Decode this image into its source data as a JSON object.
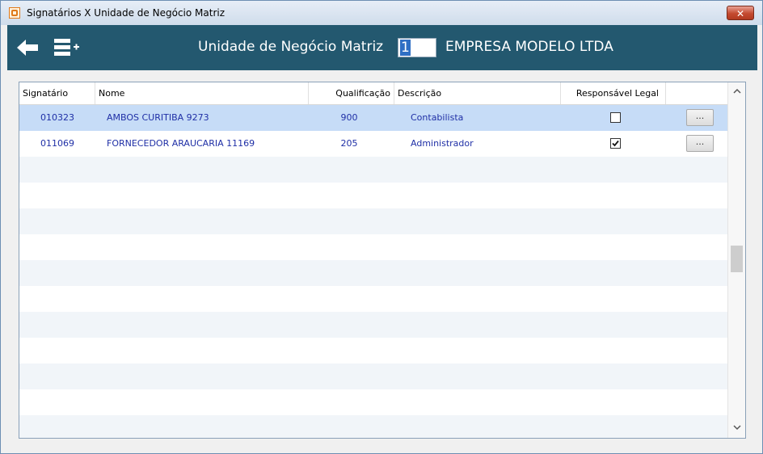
{
  "window": {
    "title": "Signatários X Unidade de Negócio Matriz",
    "close_label": "✕"
  },
  "toolbar": {
    "label": "Unidade de Negócio Matriz",
    "input_value": "1",
    "company": "EMPRESA MODELO LTDA"
  },
  "grid": {
    "headers": {
      "signatario": "Signatário",
      "nome": "Nome",
      "qualificacao": "Qualificação",
      "descricao": "Descrição",
      "responsavel": "Responsável Legal"
    },
    "rows": [
      {
        "signatario": "010323",
        "nome": "AMBOS CURITIBA 9273",
        "qualificacao": "900",
        "descricao": "Contabilista",
        "responsavel_legal": false,
        "action_label": "..."
      },
      {
        "signatario": "011069",
        "nome": "FORNECEDOR ARAUCARIA 11169",
        "qualificacao": "205",
        "descricao": "Administrador",
        "responsavel_legal": true,
        "action_label": "..."
      }
    ]
  },
  "colors": {
    "toolbar_bg": "#23586f",
    "selected_row": "#c6dcf7",
    "cell_text": "#1f2fa6"
  },
  "icons": [
    "app-logo-icon",
    "close-icon",
    "back-arrow-icon",
    "menu-add-icon",
    "scroll-up-icon",
    "scroll-down-icon"
  ]
}
